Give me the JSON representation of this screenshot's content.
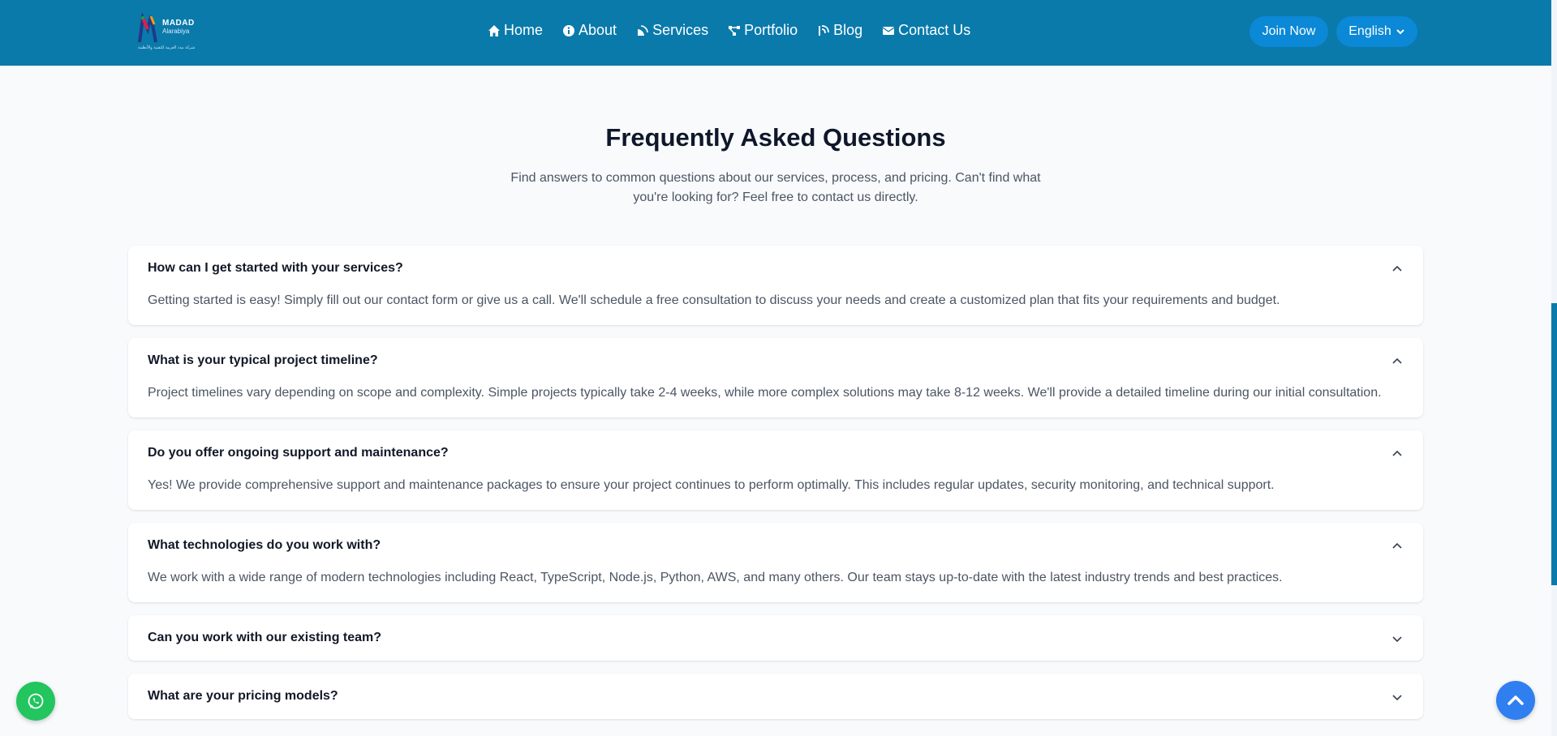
{
  "header": {
    "logo": {
      "name": "MADAD",
      "sub": "Alarabiya",
      "tagline": "شركة مدد العربية للتقنية والأنظمة"
    },
    "nav": [
      {
        "label": "Home",
        "icon": "home-icon"
      },
      {
        "label": "About",
        "icon": "info-icon"
      },
      {
        "label": "Services",
        "icon": "satellite-dish-icon"
      },
      {
        "label": "Portfolio",
        "icon": "project-diagram-icon"
      },
      {
        "label": "Blog",
        "icon": "blog-icon"
      },
      {
        "label": "Contact Us",
        "icon": "envelope-icon"
      }
    ],
    "join_label": "Join Now",
    "language_label": "English"
  },
  "faq_section": {
    "title": "Frequently Asked Questions",
    "subtitle": "Find answers to common questions about our services, process, and pricing. Can't find what you're looking for? Feel free to contact us directly.",
    "items": [
      {
        "question": "How can I get started with your services?",
        "answer": "Getting started is easy! Simply fill out our contact form or give us a call. We'll schedule a free consultation to discuss your needs and create a customized plan that fits your requirements and budget.",
        "expanded": true
      },
      {
        "question": "What is your typical project timeline?",
        "answer": "Project timelines vary depending on scope and complexity. Simple projects typically take 2-4 weeks, while more complex solutions may take 8-12 weeks. We'll provide a detailed timeline during our initial consultation.",
        "expanded": true
      },
      {
        "question": "Do you offer ongoing support and maintenance?",
        "answer": "Yes! We provide comprehensive support and maintenance packages to ensure your project continues to perform optimally. This includes regular updates, security monitoring, and technical support.",
        "expanded": true
      },
      {
        "question": "What technologies do you work with?",
        "answer": "We work with a wide range of modern technologies including React, TypeScript, Node.js, Python, AWS, and many others. Our team stays up-to-date with the latest industry trends and best practices.",
        "expanded": true
      },
      {
        "question": "Can you work with our existing team?",
        "expanded": false
      },
      {
        "question": "What are your pricing models?",
        "expanded": false
      }
    ]
  },
  "floating": {
    "whatsapp_icon": "whatsapp-icon",
    "scroll_top_icon": "chevron-up-icon"
  },
  "colors": {
    "header_bg": "#0a7aab",
    "button_bg": "#0b88d6",
    "whatsapp": "#22c55e",
    "scroll_top": "#2f7ff0",
    "page_bg": "#f8fafc"
  }
}
